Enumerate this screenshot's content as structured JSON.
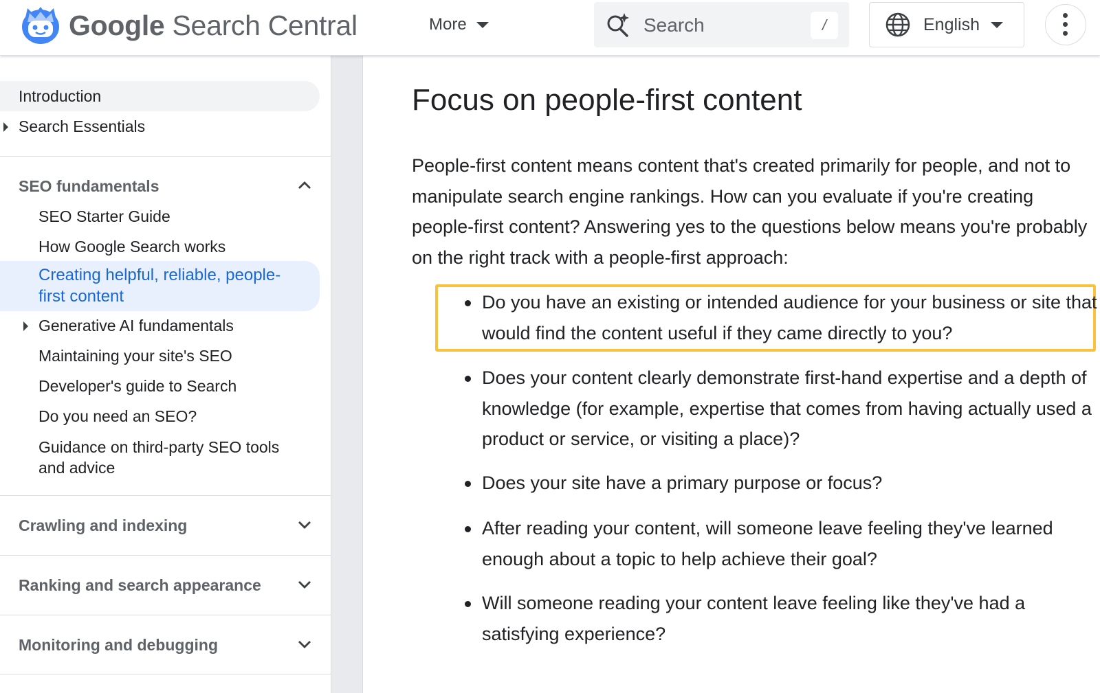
{
  "header": {
    "brand_google": "Google",
    "brand_product": "Search Central",
    "more_label": "More",
    "search_placeholder": "Search",
    "search_shortcut": "/",
    "language_label": "English"
  },
  "sidebar": {
    "top_items": [
      {
        "label": "Introduction"
      },
      {
        "label": "Search Essentials"
      }
    ],
    "sections": [
      {
        "title": "SEO fundamentals",
        "expanded": true,
        "items": [
          {
            "label": "SEO Starter Guide"
          },
          {
            "label": "How Google Search works"
          },
          {
            "label": "Creating helpful, reliable, people-first content",
            "active": true
          },
          {
            "label": "Generative AI fundamentals"
          },
          {
            "label": "Maintaining your site's SEO"
          },
          {
            "label": "Developer's guide to Search"
          },
          {
            "label": "Do you need an SEO?"
          },
          {
            "label": "Guidance on third-party SEO tools and advice"
          }
        ]
      },
      {
        "title": "Crawling and indexing",
        "expanded": false
      },
      {
        "title": "Ranking and search appearance",
        "expanded": false
      },
      {
        "title": "Monitoring and debugging",
        "expanded": false
      }
    ]
  },
  "main": {
    "title": "Focus on people-first content",
    "intro": "People-first content means content that's created primarily for people, and not to manipulate search engine rankings. How can you evaluate if you're creating people-first content? Answering yes to the questions below means you're probably on the right track with a people-first approach:",
    "questions": [
      "Do you have an existing or intended audience for your business or site that would find the content useful if they came directly to you?",
      "Does your content clearly demonstrate first-hand expertise and a depth of knowledge (for example, expertise that comes from having actually used a product or service, or visiting a place)?",
      "Does your site have a primary purpose or focus?",
      "After reading your content, will someone leave feeling they've learned enough about a topic to help achieve their goal?",
      "Will someone reading your content leave feeling like they've had a satisfying experience?"
    ],
    "highlighted_question_index": 0
  },
  "colors": {
    "accent_blue": "#1967d2",
    "active_bg": "#e8f0fe",
    "highlight_border": "#f9c23c",
    "logo_blue": "#4285f4"
  },
  "icons": [
    "search-central-logo-icon",
    "chevron-down-icon",
    "sparkle-search-icon",
    "globe-icon",
    "more-vert-icon",
    "expand-triangle-icon",
    "chevron-up-icon"
  ]
}
